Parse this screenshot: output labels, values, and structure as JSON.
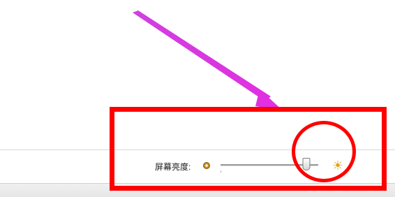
{
  "status_bar": {
    "brightness_label": "屏幕亮度:",
    "brightness_level_percent": 88,
    "dim_icon": "dim-sun-icon",
    "bright_icon": "bright-sun-icon"
  },
  "annotations": {
    "box_color": "#ff0000",
    "arrow_color": "#e030e0"
  }
}
